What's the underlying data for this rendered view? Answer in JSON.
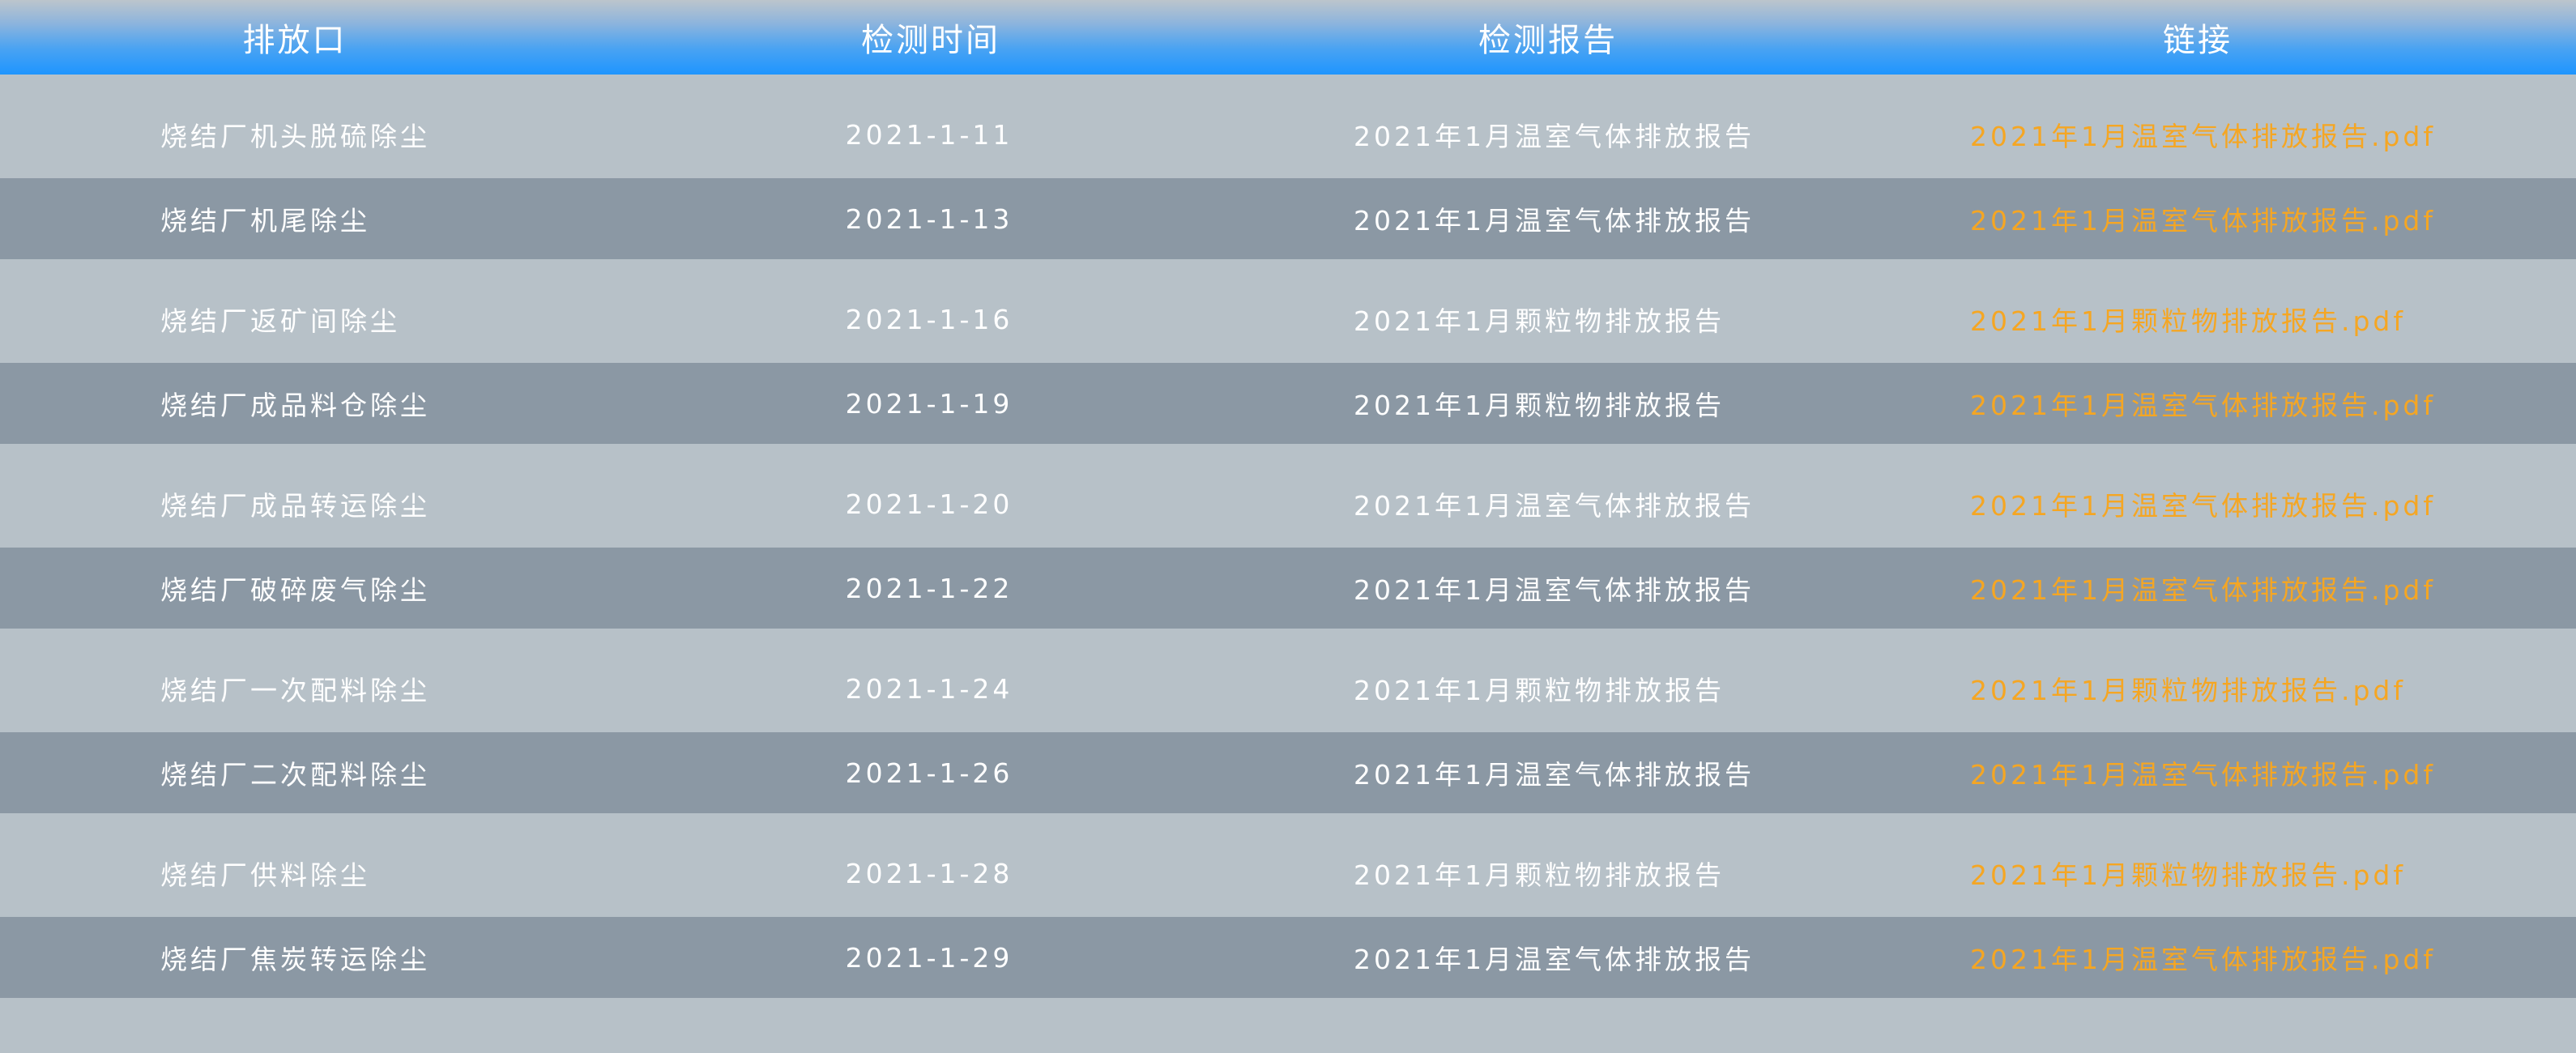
{
  "table": {
    "headers": [
      "排放口",
      "检测时间",
      "检测报告",
      "链接"
    ],
    "rows": [
      {
        "outlet": "烧结厂机头脱硫除尘",
        "time": "2021-1-11",
        "report": "2021年1月温室气体排放报告",
        "link": "2021年1月温室气体排放报告.pdf"
      },
      {
        "outlet": "烧结厂机尾除尘",
        "time": "2021-1-13",
        "report": "2021年1月温室气体排放报告",
        "link": "2021年1月温室气体排放报告.pdf"
      },
      {
        "outlet": "烧结厂返矿间除尘",
        "time": "2021-1-16",
        "report": "2021年1月颗粒物排放报告",
        "link": "2021年1月颗粒物排放报告.pdf"
      },
      {
        "outlet": "烧结厂成品料仓除尘",
        "time": "2021-1-19",
        "report": "2021年1月颗粒物排放报告",
        "link": "2021年1月温室气体排放报告.pdf"
      },
      {
        "outlet": "烧结厂成品转运除尘",
        "time": "2021-1-20",
        "report": "2021年1月温室气体排放报告",
        "link": "2021年1月温室气体排放报告.pdf"
      },
      {
        "outlet": "烧结厂破碎废气除尘",
        "time": "2021-1-22",
        "report": "2021年1月温室气体排放报告",
        "link": "2021年1月温室气体排放报告.pdf"
      },
      {
        "outlet": "烧结厂一次配料除尘",
        "time": "2021-1-24",
        "report": "2021年1月颗粒物排放报告",
        "link": "2021年1月颗粒物排放报告.pdf"
      },
      {
        "outlet": "烧结厂二次配料除尘",
        "time": "2021-1-26",
        "report": "2021年1月温室气体排放报告",
        "link": "2021年1月温室气体排放报告.pdf"
      },
      {
        "outlet": "烧结厂供料除尘",
        "time": "2021-1-28",
        "report": "2021年1月颗粒物排放报告",
        "link": "2021年1月颗粒物排放报告.pdf"
      },
      {
        "outlet": "烧结厂焦炭转运除尘",
        "time": "2021-1-29",
        "report": "2021年1月温室气体排放报告",
        "link": "2021年1月温室气体排放报告.pdf"
      }
    ]
  },
  "colors": {
    "header_gradient_bottom": "#1e95ff",
    "row_light": "#b7c1c8",
    "row_dark": "#8b98a4",
    "text": "#ffffff",
    "link": "#f5a623"
  }
}
